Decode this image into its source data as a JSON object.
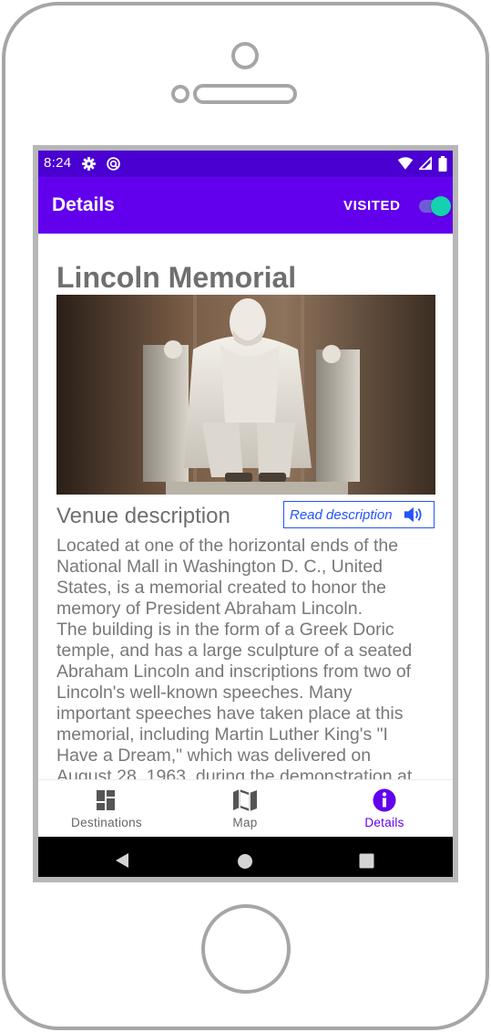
{
  "status_bar": {
    "time": "8:24",
    "icons_left": [
      "settings-icon",
      "sync-icon"
    ],
    "icons_right": [
      "wifi-icon",
      "signal-icon",
      "battery-icon"
    ],
    "background": "#4a00d1"
  },
  "app_bar": {
    "title": "Details",
    "visited_label": "VISITED",
    "visited_on": true,
    "background": "#6200ee",
    "switch_color": "#14d2b0"
  },
  "venue": {
    "title": "Lincoln Memorial",
    "image_alt": "Lincoln Memorial statue",
    "description_heading": "Venue description",
    "read_button_label": "Read description",
    "read_button_icon": "volume-icon",
    "description": "Located at one of the horizontal ends of the National Mall in Washington D. C., United States, is a memorial created to honor the memory of President Abraham Lincoln.\nThe building is in the form of a Greek Doric temple, and has a large sculpture of a seated Abraham Lincoln and inscriptions from two of Lincoln's well-known speeches. Many important speeches have taken place at this memorial, including Martin Luther King's \"I Have a Dream,\" which was delivered on August 28, 1963, during the demonstration at"
  },
  "bottom_nav": {
    "items": [
      {
        "label": "Destinations",
        "icon": "dashboard-icon",
        "active": false
      },
      {
        "label": "Map",
        "icon": "map-icon",
        "active": false
      },
      {
        "label": "Details",
        "icon": "info-icon",
        "active": true
      }
    ],
    "active_color": "#6200ee"
  },
  "system_nav": {
    "buttons": [
      "back-icon",
      "home-icon",
      "recents-icon"
    ]
  }
}
